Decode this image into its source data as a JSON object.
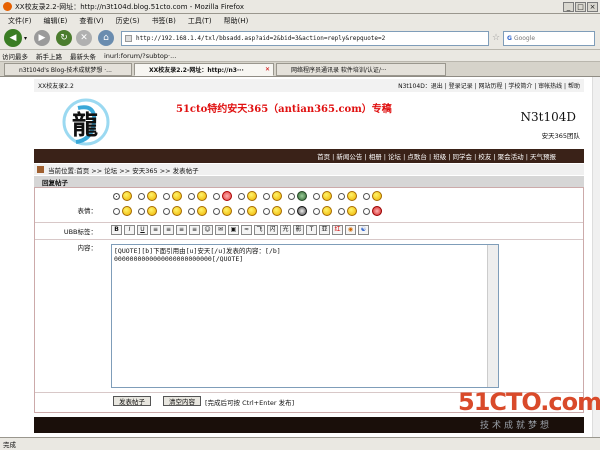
{
  "window": {
    "title": "XX校友录2.2-网址：http://n3t104d.blog.51cto.com - Mozilla Firefox"
  },
  "menu": [
    "文件(F)",
    "编辑(E)",
    "查看(V)",
    "历史(S)",
    "书签(B)",
    "工具(T)",
    "帮助(H)"
  ],
  "nav": {
    "url": "http://192.168.1.4/txl/bbsadd.asp?aid=2&bid=3&action=reply&repquote=2",
    "search_placeholder": "Google"
  },
  "bookmarks": [
    "访问最多",
    "新手上路",
    "最新头条",
    "inurl:forum/?subtop·..."
  ],
  "tabs": [
    "n3t104d's Blog-技术成就梦想 ·...",
    "XX校友录2.2-网址：http://n3···",
    "网络程序员通讯录 软件培训/认证/···"
  ],
  "site": {
    "top_left": "XX校友录2.2",
    "top_links": "N3t104D：退出 | 登录记录 | 网站历程 | 学校简介 | 审帐热线 | 帮助",
    "banner_text": "51cto特约安天365（antian365.com）专稿",
    "brand": "N3t104D",
    "brand_sub": "安天365团队",
    "menu": "首页 | 新闻公告 | 相册 | 论坛 | 点歌台 | 班级 | 同学会 | 校友 | 聚会活动 | 天气预报",
    "breadcrumb": "当前位置:首页 >> 论坛 >> 安天365 >> 发表帖子",
    "section_title": "回复帖子",
    "emotion_label": "表情：",
    "ubb_label": "UBB标签：",
    "content_label": "内容：",
    "ubb_buttons": [
      "B",
      "I",
      "U",
      "≡",
      "≡",
      "≡",
      "≡",
      "☺",
      "✉",
      "▣",
      "≈",
      "飞",
      "闪",
      "光",
      "影",
      "T",
      "亚",
      "红",
      "◉",
      "☯"
    ],
    "editor_text": "[QUOTE][b]下面引用由[u]安天[/u]发表的内容：[/b]\n0000000000000000000000000[/QUOTE]",
    "submit": "发表帖子",
    "clear": "清空内容",
    "hint": "[完成后可按 Ctrl+Enter 发布]"
  },
  "status": "完成",
  "watermark": {
    "main": "51CTO.com",
    "sub": "技术成就梦想"
  }
}
